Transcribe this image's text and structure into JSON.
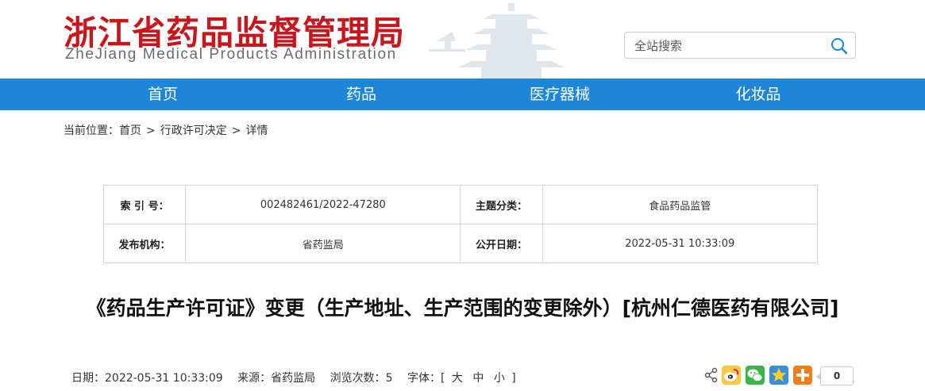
{
  "header": {
    "logo_cn": "浙江省药品监督管理局",
    "logo_en": "ZheJiang Medical Products Administration",
    "search_placeholder": "全站搜索"
  },
  "nav": {
    "items": [
      {
        "label": "首页"
      },
      {
        "label": "药品"
      },
      {
        "label": "医疗器械"
      },
      {
        "label": "化妆品"
      }
    ]
  },
  "breadcrumb": {
    "prefix": "当前位置：",
    "items": [
      "首页",
      "行政许可决定",
      "详情"
    ],
    "separator": ">"
  },
  "meta": {
    "index_label": "索 引 号：",
    "index_value": "002482461/2022-47280",
    "topic_label": "主题分类：",
    "topic_value": "食品药品监管",
    "org_label": "发布机构：",
    "org_value": "省药监局",
    "date_label": "公开日期：",
    "date_value": "2022-05-31 10:33:09"
  },
  "article": {
    "title": "《药品生产许可证》变更（生产地址、生产范围的变更除外）[杭州仁德医药有限公司]"
  },
  "info_bar": {
    "date": "日期：2022-05-31 10:33:09",
    "source": "来源：省药监局",
    "views": "浏览次数：5",
    "font_label": "字体：[",
    "font_large": "大",
    "font_medium": "中",
    "font_small": "小",
    "font_end": "]"
  },
  "share": {
    "icons": [
      "share-icon",
      "weibo-icon",
      "wechat-icon",
      "qzone-icon",
      "more-icon"
    ],
    "count": "0"
  },
  "colors": {
    "brand_red": "#c8161d",
    "nav_blue": "#1d86d9"
  }
}
